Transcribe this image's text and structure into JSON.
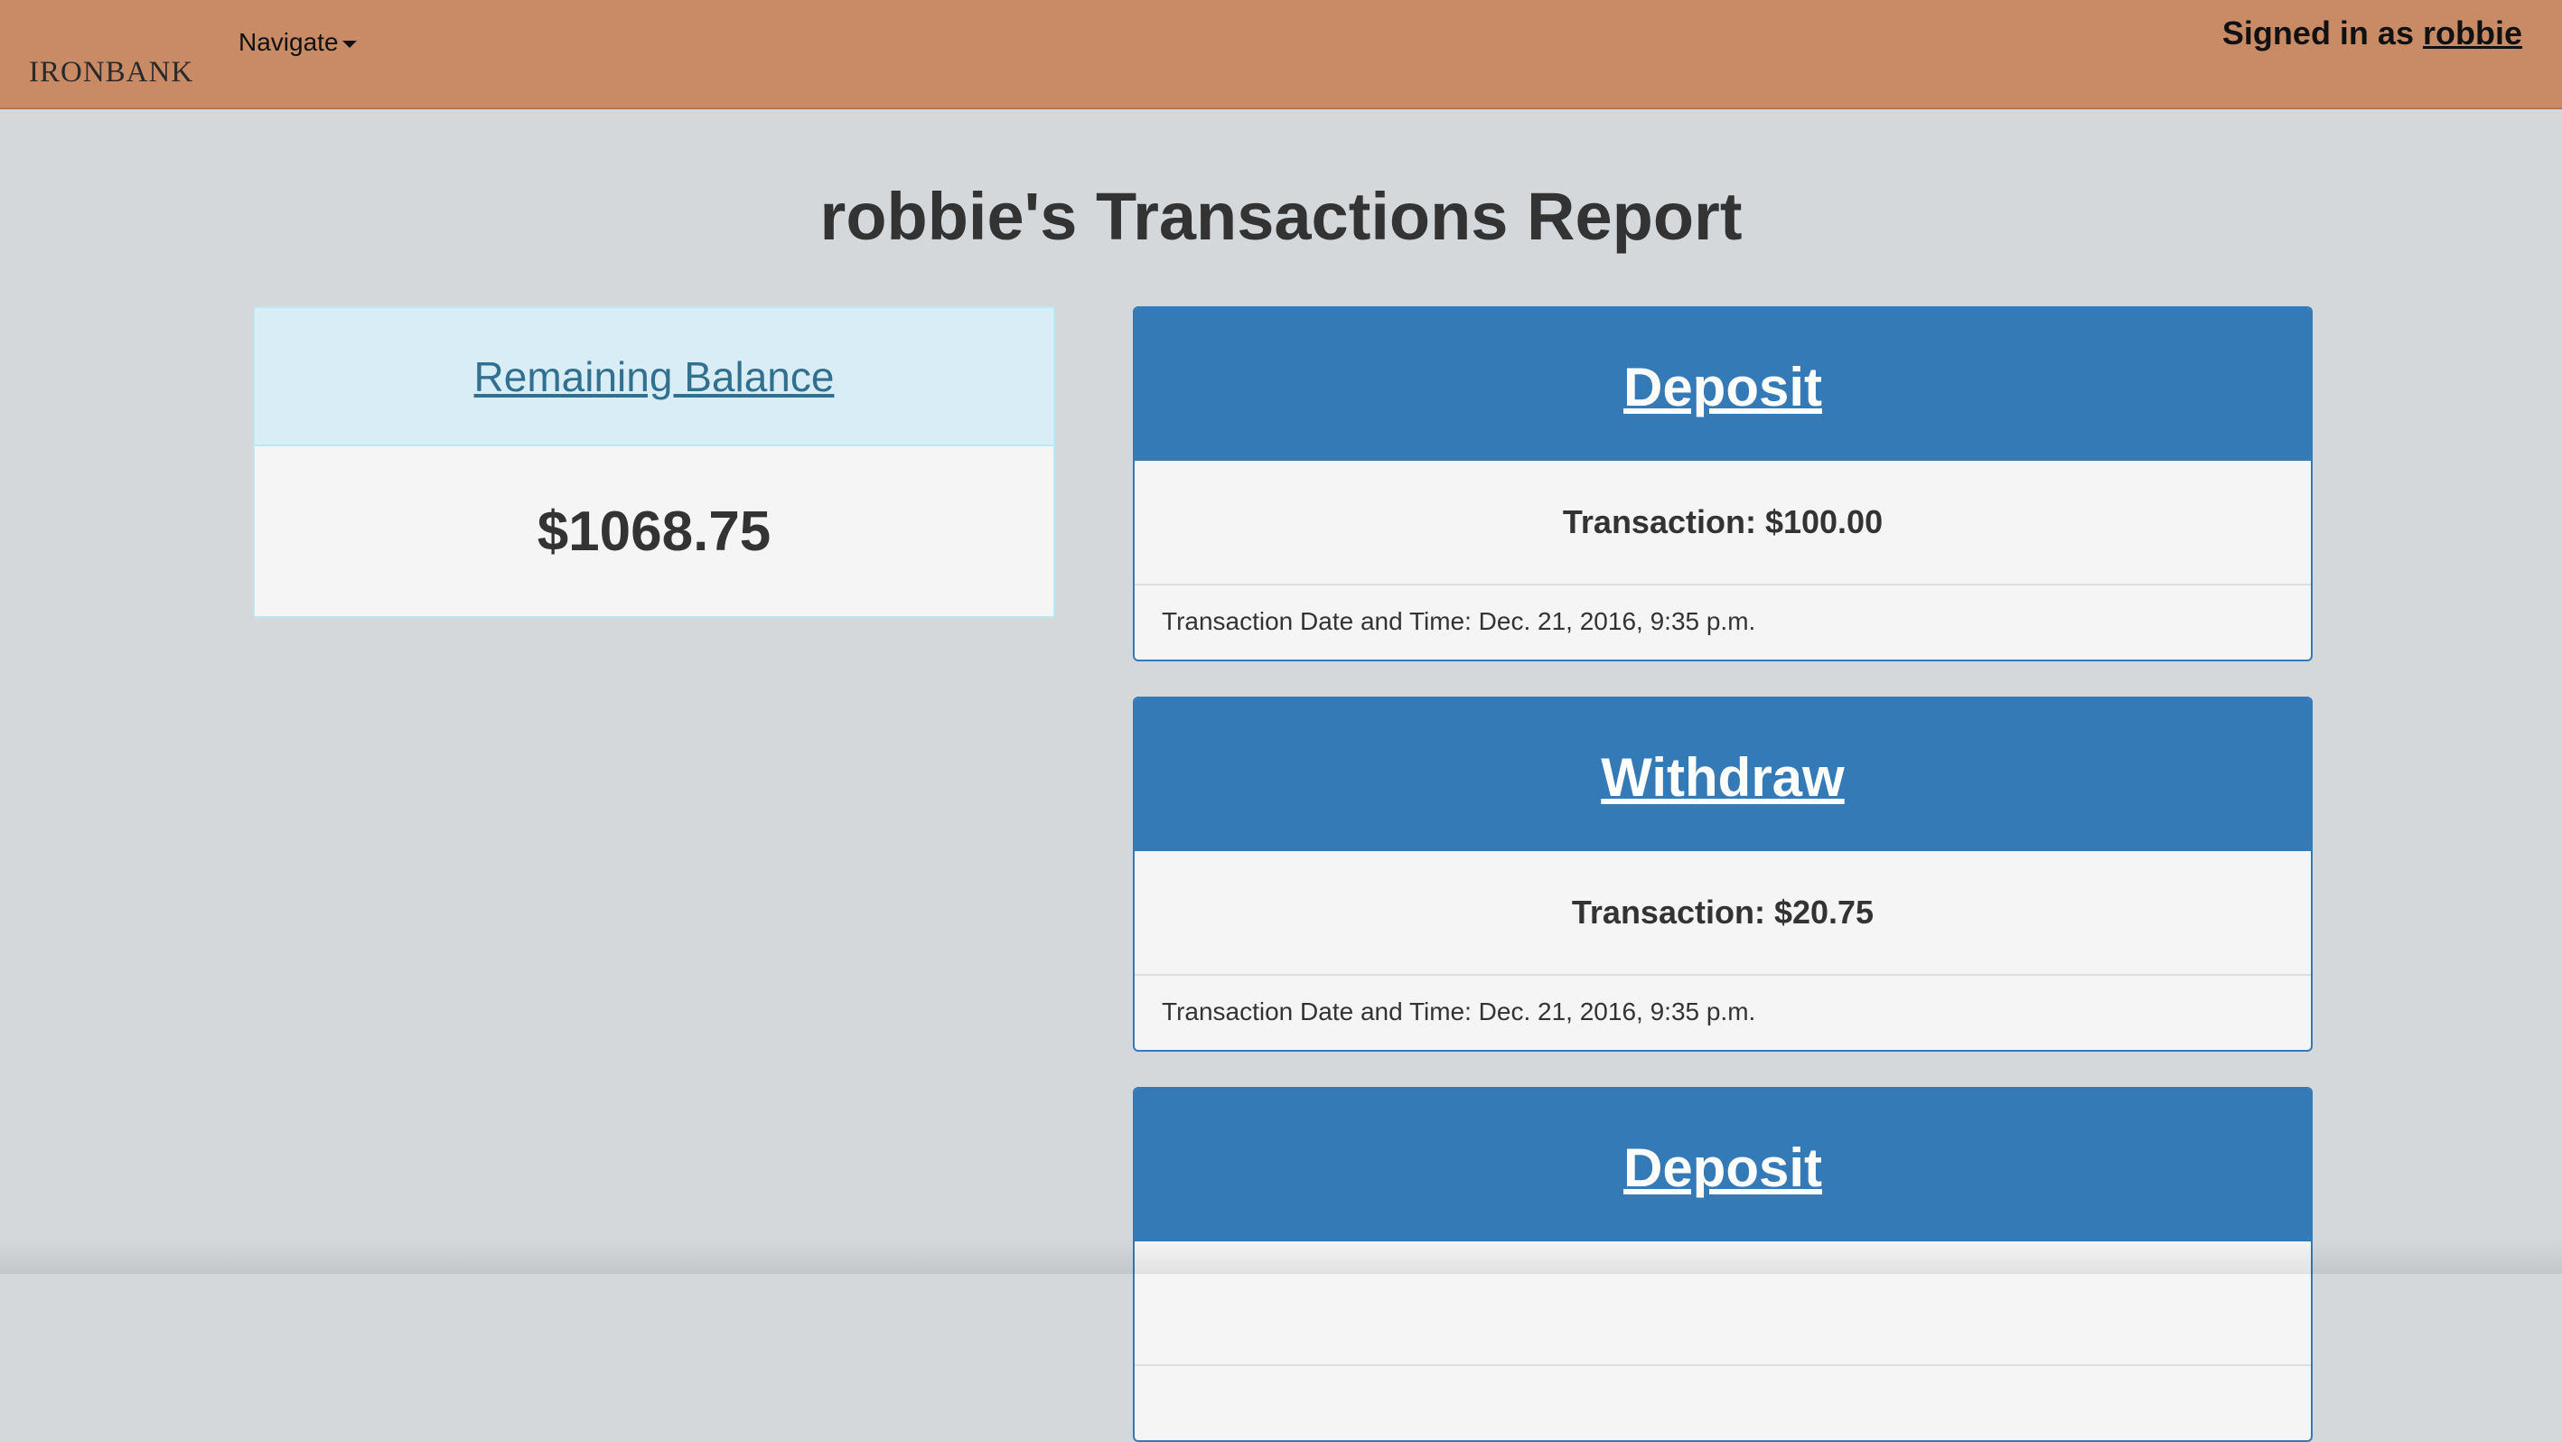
{
  "navbar": {
    "brand": "IRONBANK",
    "navigate_label": "Navigate",
    "signed_in_prefix": "Signed in as",
    "username": "robbie"
  },
  "page": {
    "title": "robbie's Transactions Report"
  },
  "balance": {
    "heading": "Remaining Balance",
    "amount": "$1068.75"
  },
  "transactions": [
    {
      "type": "Deposit",
      "amount_text": "Transaction: $100.00",
      "datetime_text": "Transaction Date and Time: Dec. 21, 2016, 9:35 p.m."
    },
    {
      "type": "Withdraw",
      "amount_text": "Transaction: $20.75",
      "datetime_text": "Transaction Date and Time: Dec. 21, 2016, 9:35 p.m."
    },
    {
      "type": "Deposit",
      "amount_text": "",
      "datetime_text": ""
    }
  ],
  "colors": {
    "navbar": "#c98b66",
    "background": "#d4d8db",
    "primary": "#337ab7",
    "info_bg": "#d9edf7",
    "info_text": "#31708f"
  }
}
